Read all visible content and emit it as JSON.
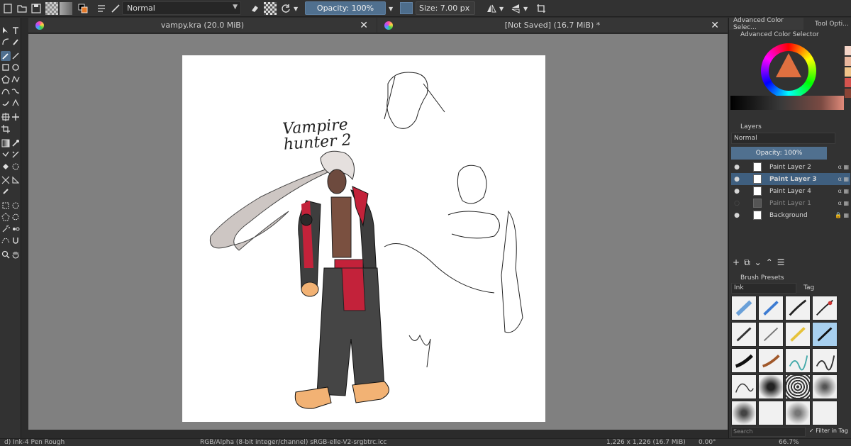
{
  "toolbar": {
    "blend_mode": "Normal",
    "opacity": "Opacity: 100%",
    "size": "Size: 7.00 px"
  },
  "tabs": [
    {
      "title": "vampy.kra (20.0 MiB)"
    },
    {
      "title": "[Not Saved]  (16.7 MiB) *"
    }
  ],
  "canvas": {
    "handwriting": "Vampire hunter 2"
  },
  "dock": {
    "tabs": [
      "Advanced Color Selec...",
      "Tool Opti..."
    ],
    "color_selector_title": "Advanced Color Selector",
    "layers_title": "Layers",
    "layers_blend": "Normal",
    "layers_opacity": "Opacity:  100%",
    "layers": [
      {
        "name": "Paint Layer 2",
        "visible": true,
        "selected": false
      },
      {
        "name": "Paint Layer 3",
        "visible": true,
        "selected": true
      },
      {
        "name": "Paint Layer 4",
        "visible": true,
        "selected": false
      },
      {
        "name": "Paint Layer 1",
        "visible": false,
        "selected": false
      },
      {
        "name": "Background",
        "visible": true,
        "selected": false
      }
    ],
    "brush_presets_title": "Brush Presets",
    "brush_tag_filter": "Ink",
    "brush_tag_label": "Tag",
    "search_placeholder": "Search",
    "filter_in_tag": "Filter in Tag"
  },
  "statusbar": {
    "brush": "d) Ink-4 Pen Rough",
    "colorspace": "RGB/Alpha (8-bit integer/channel)  sRGB-elle-V2-srgbtrc.icc",
    "dimensions": "1,226 x 1,226 (16.7 MiB)",
    "rotation": "0.00°",
    "zoom": "66.7%"
  },
  "colors": {
    "accent": "#4f6f8f",
    "canvas_bg": "#808080",
    "panel_bg": "#323232"
  }
}
